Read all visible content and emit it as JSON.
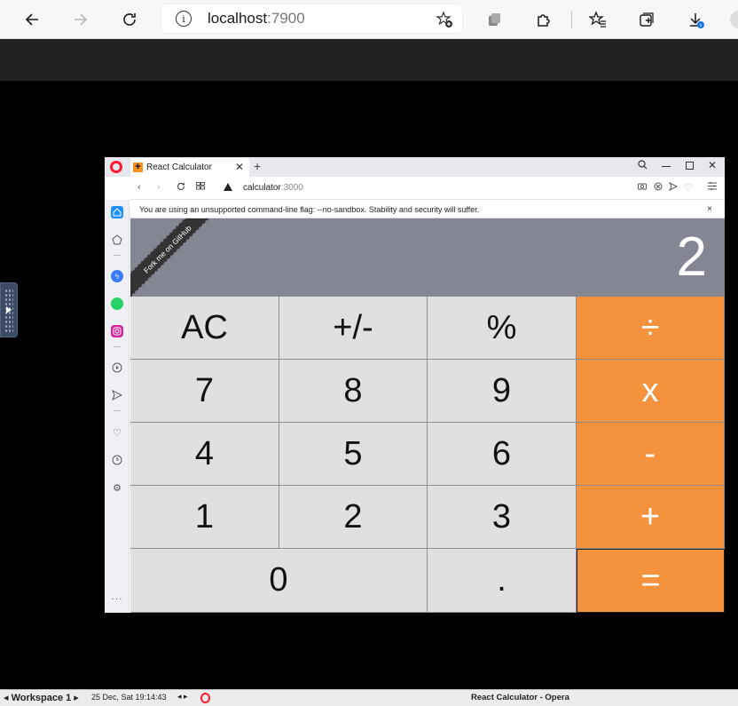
{
  "outer_browser": {
    "address_host": "localhost",
    "address_port": ":7900"
  },
  "opera": {
    "tab_title": "React Calculator",
    "tab_favicon": "+",
    "tab_close": "✕",
    "new_tab": "+",
    "url_host": "calculator",
    "url_port": ":3000",
    "infobar_message": "You are using an unsupported command-line flag: --no-sandbox. Stability and security will suffer.",
    "infobar_close": "×"
  },
  "calculator": {
    "ribbon": "Fork me on GitHub",
    "display": "2",
    "keys": {
      "ac": "AC",
      "sign": "+/-",
      "percent": "%",
      "divide": "÷",
      "k7": "7",
      "k8": "8",
      "k9": "9",
      "multiply": "x",
      "k4": "4",
      "k5": "5",
      "k6": "6",
      "minus": "-",
      "k1": "1",
      "k2": "2",
      "k3": "3",
      "plus": "+",
      "k0": "0",
      "dot": ".",
      "equals": "="
    }
  },
  "colors": {
    "operator": "#f5923e",
    "key": "#e0e0e0",
    "display_bg": "#858694"
  },
  "taskbar": {
    "workspace": "◂ Workspace 1 ▸",
    "datetime": "25 Dec, Sat 19:14:43",
    "nav": "◂ ▸",
    "window_title": "React Calculator - Opera"
  }
}
